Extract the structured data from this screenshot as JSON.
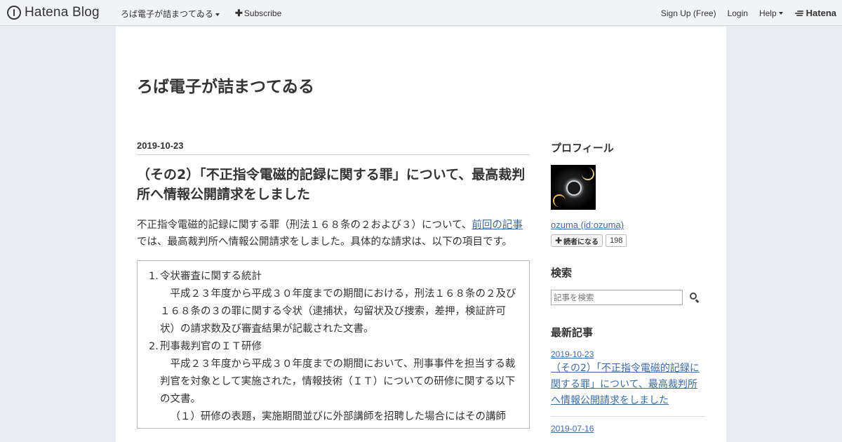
{
  "globalbar": {
    "logo_text": "Hatena Blog",
    "blog_name": "ろば電子が詰まつてゐる",
    "subscribe_label": "Subscribe",
    "signup_label": "Sign Up (Free)",
    "login_label": "Login",
    "help_label": "Help",
    "hatena_label": "Hatena"
  },
  "blog": {
    "title": "ろば電子が詰まつてゐる"
  },
  "entry": {
    "date": "2019-10-23",
    "title": "（その2）「不正指令電磁的記録に関する罪」について、最高裁判所へ情報公開請求をしました",
    "intro_before_link": "不正指令電磁的記録に関する罪（刑法１６８条の２および３）について、",
    "intro_link": "前回の記事",
    "intro_after_link": "では、最高裁判所へ情報公開請求をしました。具体的な請求は、以下の項目です。",
    "items": [
      {
        "num": "1.",
        "title": "令状審査に関する統計",
        "detail": "平成２３年度から平成３０年度までの期間における，刑法１６８条の２及び１６８条の３の罪に関する令状（逮捕状，勾留状及び捜索，差押，検証許可状）の請求数及び審査結果が記載された文書。"
      },
      {
        "num": "2.",
        "title": "刑事裁判官のＩＴ研修",
        "detail": "平成２３年度から平成３０年度までの期間において、刑事事件を担当する裁判官を対象として実施された，情報技術（ＩＴ）についての研修に関する以下の文書。",
        "sub": "（１）研修の表題，実施期間並びに外部講師を招聘した場合にはその講師"
      }
    ]
  },
  "sidebar": {
    "profile_heading": "プロフィール",
    "profile_name": "ozuma (id:ozuma)",
    "subscribe_button": "読者になる",
    "reader_count": "198",
    "search_heading": "検索",
    "search_placeholder": "記事を検索",
    "recent_heading": "最新記事",
    "recent": [
      {
        "date": "2019-10-23",
        "title": "（その2）「不正指令電磁的記録に関する罪」について、最高裁判所へ情報公開請求をしました"
      },
      {
        "date": "2019-07-16",
        "title": ""
      }
    ]
  },
  "colors": {
    "link": "#3b6ba5",
    "header_bg": "#f1f3f6",
    "page_bg": "#eaedf2"
  }
}
